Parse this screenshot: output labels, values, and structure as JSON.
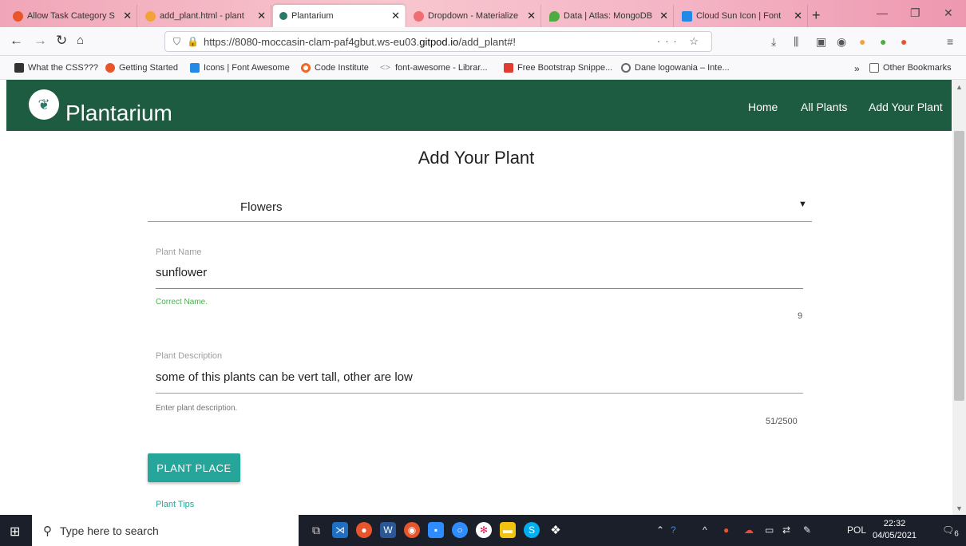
{
  "browser": {
    "tabs": [
      {
        "title": "Allow Task Category S",
        "color": "#e8552a",
        "active": false
      },
      {
        "title": "add_plant.html - plant",
        "color": "#f1a33a",
        "active": false
      },
      {
        "title": "Plantarium",
        "color": "#2a7a6a",
        "active": true
      },
      {
        "title": "Dropdown - Materialize",
        "color": "#ee6e73",
        "active": false
      },
      {
        "title": "Data | Atlas: MongoDB",
        "color": "#4faa41",
        "active": false
      },
      {
        "title": "Cloud Sun Icon | Font",
        "color": "#228ae6",
        "active": false
      }
    ],
    "url_prefix": "https://8080-moccasin-clam-paf4gbut.ws-eu03.",
    "url_domain": "gitpod.io",
    "url_path": "/add_plant#!",
    "bookmarks": [
      {
        "label": "What the CSS???",
        "color": "#333333"
      },
      {
        "label": "Getting Started",
        "color": "#e8552a"
      },
      {
        "label": "Icons | Font Awesome",
        "color": "#228ae6"
      },
      {
        "label": "Code Institute",
        "color": "#f26522"
      },
      {
        "label": "font-awesome - Librar...",
        "color": "#999999"
      },
      {
        "label": "Free Bootstrap Snippe...",
        "color": "#e03c31"
      },
      {
        "label": "Dane logowania – Inte...",
        "color": "#666666"
      }
    ],
    "other_bookmarks": "Other Bookmarks"
  },
  "site": {
    "brand": "Plantarium",
    "nav": [
      "Home",
      "All Plants",
      "Add Your Plant"
    ]
  },
  "form": {
    "title": "Add Your Plant",
    "category_value": "Flowers",
    "name_label": "Plant Name",
    "name_value": "sunflower",
    "name_helper": "Correct Name.",
    "name_counter": "9",
    "desc_label": "Plant Description",
    "desc_value": "some of this plants can be vert tall, other are low",
    "desc_helper": "Enter plant description.",
    "desc_counter": "51/2500",
    "button_label": "PLANT PLACE",
    "tips_label": "Plant Tips"
  },
  "taskbar": {
    "search_placeholder": "Type here to search",
    "lang": "POL",
    "time": "22:32",
    "date": "04/05/2021",
    "notifications": "6"
  }
}
